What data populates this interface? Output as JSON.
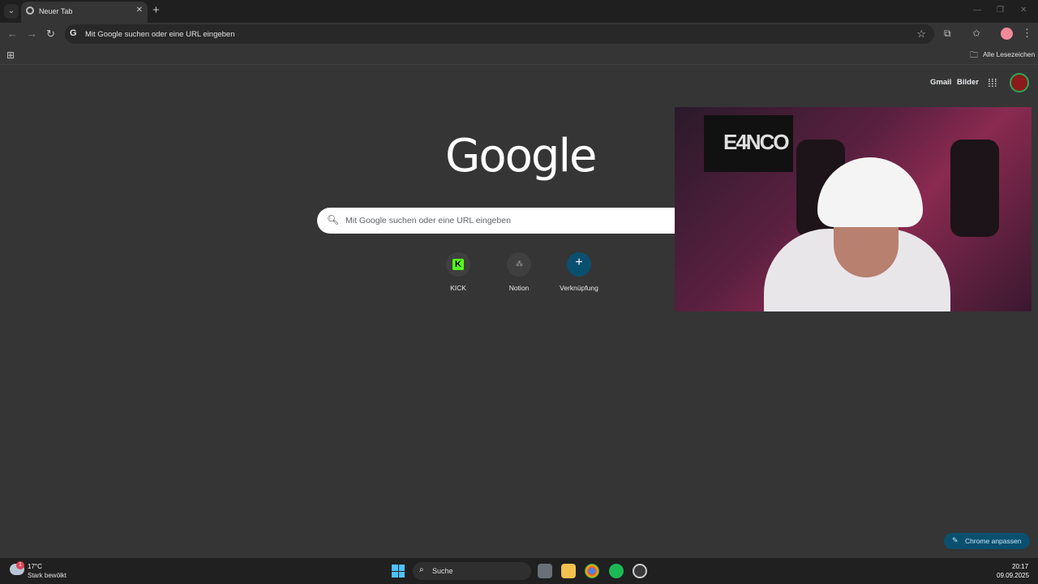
{
  "browser": {
    "tab_title": "Neuer Tab",
    "tab_close": "✕",
    "new_tab": "+",
    "menu_caret": "⌄",
    "omnibox_text": "Mit Google suchen oder eine URL eingeben",
    "omnibox_g": "G",
    "bookmarks_all": "Alle Lesezeichen"
  },
  "ntp": {
    "gmail": "Gmail",
    "images": "Bilder",
    "logo": "Google",
    "search_placeholder": "Mit Google suchen oder eine URL eingeben",
    "shortcuts": [
      {
        "label": "KICK",
        "icon": "kick-icon"
      },
      {
        "label": "Notion",
        "icon": "notion-icon"
      },
      {
        "label": "Verknüpfung",
        "icon": "plus-icon"
      }
    ],
    "customize": "Chrome anpassen"
  },
  "webcam": {
    "monitor_text": "E4NCO"
  },
  "taskbar": {
    "weather_badge": "1",
    "temperature": "17°C",
    "weather_desc": "Stark bewölkt",
    "search_label": "Suche",
    "time": "20:17",
    "date": "09.09.2025"
  },
  "colors": {
    "accent_blue": "#0b4f6e",
    "kick_green": "#53fc18",
    "start_blue": "#4cc2ff"
  }
}
